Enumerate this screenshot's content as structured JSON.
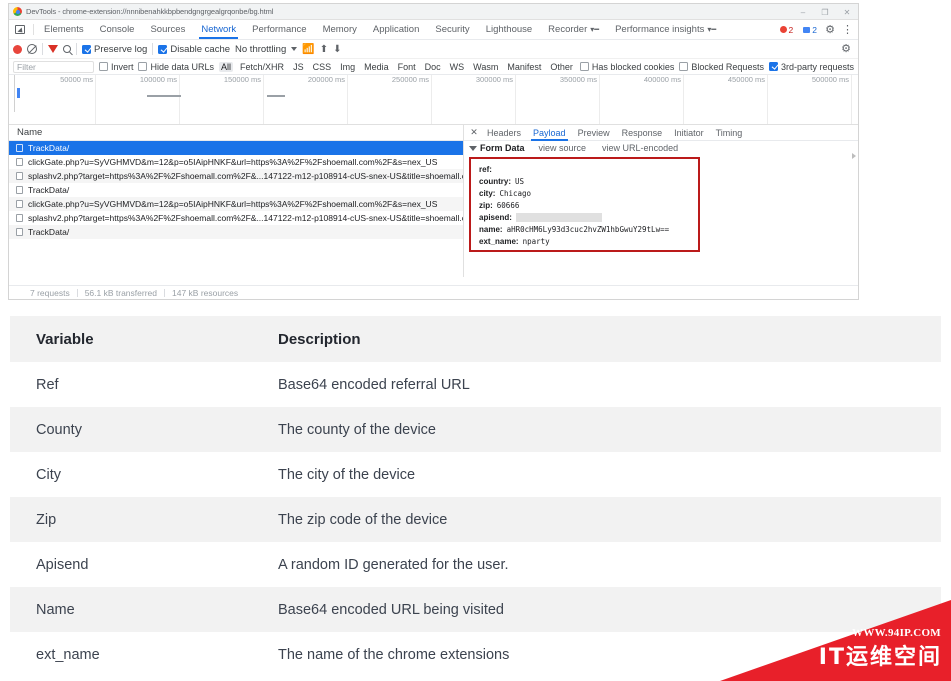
{
  "devtools": {
    "window_title": "DevTools - chrome-extension://nnnibenahkkbpbendgngrgealgrqonbe/bg.html",
    "window_controls": {
      "minimize": "–",
      "maximize": "❐",
      "close": "✕"
    },
    "main_tabs": [
      {
        "label": "Elements",
        "active": false
      },
      {
        "label": "Console",
        "active": false
      },
      {
        "label": "Sources",
        "active": false
      },
      {
        "label": "Network",
        "active": true
      },
      {
        "label": "Performance",
        "active": false
      },
      {
        "label": "Memory",
        "active": false
      },
      {
        "label": "Application",
        "active": false
      },
      {
        "label": "Security",
        "active": false
      },
      {
        "label": "Lighthouse",
        "active": false
      },
      {
        "label": "Recorder",
        "active": false,
        "download": true
      },
      {
        "label": "Performance insights",
        "active": false,
        "download": true
      }
    ],
    "badges": {
      "errors": "2",
      "warnings": "2"
    },
    "network_toolbar": {
      "preserve_log": "Preserve log",
      "preserve_log_checked": true,
      "disable_cache": "Disable cache",
      "disable_cache_checked": true,
      "throttling": "No throttling"
    },
    "filter_row": {
      "filter_placeholder": "Filter",
      "invert": "Invert",
      "hide_data_urls": "Hide data URLs",
      "types": [
        "All",
        "Fetch/XHR",
        "JS",
        "CSS",
        "Img",
        "Media",
        "Font",
        "Doc",
        "WS",
        "Wasm",
        "Manifest",
        "Other"
      ],
      "selected_type": "All",
      "has_blocked_cookies": "Has blocked cookies",
      "blocked_requests": "Blocked Requests",
      "third_party_requests": "3rd-party requests",
      "third_party_checked": true
    },
    "overview": {
      "ticks": [
        "50000 ms",
        "100000 ms",
        "150000 ms",
        "200000 ms",
        "250000 ms",
        "300000 ms",
        "350000 ms",
        "400000 ms",
        "450000 ms",
        "500000 ms"
      ]
    },
    "request_list": {
      "column_header": "Name",
      "rows": [
        {
          "name": "TrackData/",
          "selected": true
        },
        {
          "name": "clickGate.php?u=SyVGHMVD&m=12&p=o5IAipHNKF&url=https%3A%2F%2Fshoemall.com%2F&s=nex_US",
          "selected": false
        },
        {
          "name": "splashv2.php?target=https%3A%2F%2Fshoemall.com%2F&...147122-m12-p108914-cUS-snex-US&title=shoemall.com",
          "selected": false
        },
        {
          "name": "TrackData/",
          "selected": false
        },
        {
          "name": "clickGate.php?u=SyVGHMVD&m=12&p=o5IAipHNKF&url=https%3A%2F%2Fshoemall.com%2F&s=nex_US",
          "selected": false
        },
        {
          "name": "splashv2.php?target=https%3A%2F%2Fshoemall.com%2F&...147122-m12-p108914-cUS-snex-US&title=shoemall.com",
          "selected": false
        },
        {
          "name": "TrackData/",
          "selected": false
        }
      ]
    },
    "detail": {
      "tabs": [
        {
          "label": "Headers",
          "active": false
        },
        {
          "label": "Payload",
          "active": true
        },
        {
          "label": "Preview",
          "active": false
        },
        {
          "label": "Response",
          "active": false
        },
        {
          "label": "Initiator",
          "active": false
        },
        {
          "label": "Timing",
          "active": false
        }
      ],
      "close_label": "✕",
      "form_data": {
        "section_title": "Form Data",
        "view_source": "view source",
        "view_url_encoded": "view URL-encoded",
        "fields": [
          {
            "key": "ref:",
            "value": ""
          },
          {
            "key": "country:",
            "value": "US"
          },
          {
            "key": "city:",
            "value": "Chicago"
          },
          {
            "key": "zip:",
            "value": "60666"
          },
          {
            "key": "apisend:",
            "value": "",
            "redacted": true
          },
          {
            "key": "name:",
            "value": "aHR0cHM6Ly93d3cuc2hvZW1hbGwuY29tLw=="
          },
          {
            "key": "ext_name:",
            "value": "nparty"
          }
        ]
      }
    },
    "status_bar": {
      "requests": "7 requests",
      "transferred": "56.1 kB transferred",
      "resources": "147 kB resources"
    }
  },
  "variable_table": {
    "headers": {
      "variable": "Variable",
      "description": "Description"
    },
    "rows": [
      {
        "variable": "Ref",
        "description": "Base64 encoded referral URL"
      },
      {
        "variable": "County",
        "description": "The county of the device"
      },
      {
        "variable": "City",
        "description": "The city of the device"
      },
      {
        "variable": "Zip",
        "description": "The zip code of the device"
      },
      {
        "variable": "Apisend",
        "description": "A random ID generated for the user."
      },
      {
        "variable": "Name",
        "description": "Base64 encoded URL being visited"
      },
      {
        "variable": "ext_name",
        "description": "The name of the chrome extensions"
      }
    ]
  },
  "watermark": {
    "url": "WWW.94IP.COM",
    "text": "IT运维空间",
    "color": "#e8202a"
  }
}
